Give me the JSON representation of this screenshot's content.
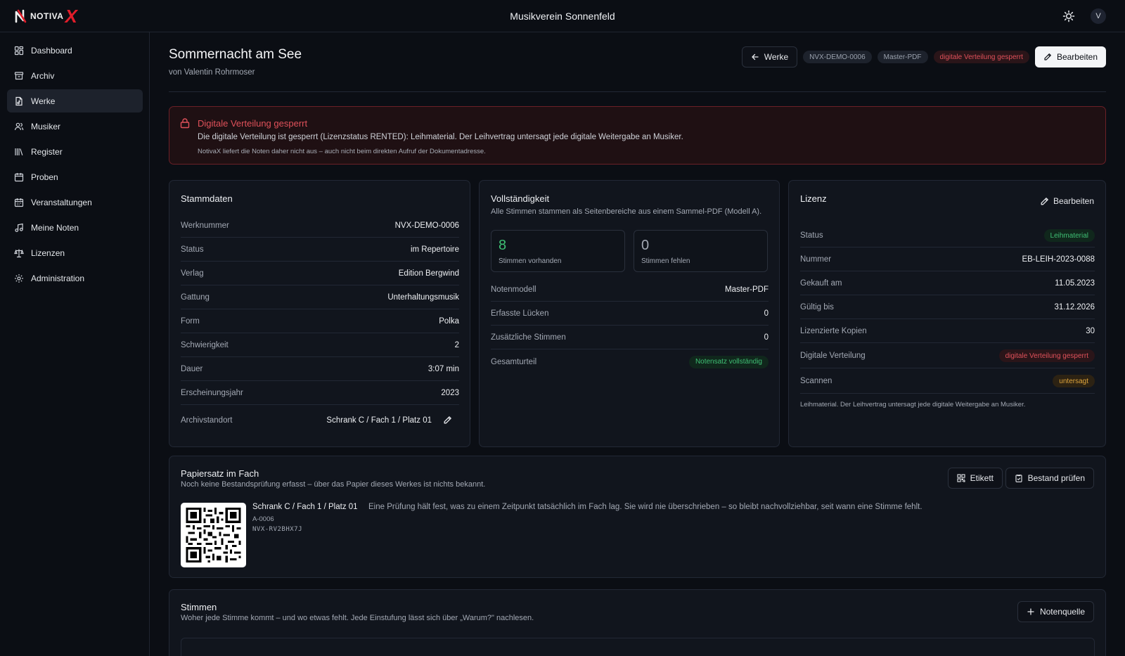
{
  "app": {
    "logo_text": "NOTIVA",
    "logo_x": "X",
    "org_name": "Musikverein Sonnenfeld",
    "avatar_initial": "V"
  },
  "sidebar": {
    "items": [
      {
        "label": "Dashboard",
        "icon": "dashboard-icon"
      },
      {
        "label": "Archiv",
        "icon": "archive-icon"
      },
      {
        "label": "Werke",
        "icon": "works-icon",
        "active": true
      },
      {
        "label": "Musiker",
        "icon": "users-icon"
      },
      {
        "label": "Register",
        "icon": "library-icon"
      },
      {
        "label": "Proben",
        "icon": "calendar-icon"
      },
      {
        "label": "Veranstaltungen",
        "icon": "calendar-icon"
      },
      {
        "label": "Meine Noten",
        "icon": "music-icon"
      },
      {
        "label": "Lizenzen",
        "icon": "scale-icon"
      },
      {
        "label": "Administration",
        "icon": "gear-icon"
      }
    ]
  },
  "header": {
    "title": "Sommernacht am See",
    "subtitle": "von Valentin Rohrmoser",
    "back_label": "Werke",
    "chips": [
      "NVX-DEMO-0006",
      "Master-PDF",
      "digitale Verteilung gesperrt"
    ],
    "edit_label": "Bearbeiten"
  },
  "alert": {
    "title": "Digitale Verteilung gesperrt",
    "text": "Die digitale Verteilung ist gesperrt (Lizenzstatus RENTED): Leihmaterial. Der Leihvertrag untersagt jede digitale Weitergabe an Musiker.",
    "note": "NotivaX liefert die Noten daher nicht aus – auch nicht beim direkten Aufruf der Dokumentadresse."
  },
  "stammdaten": {
    "title": "Stammdaten",
    "rows": [
      {
        "k": "Werknummer",
        "v": "NVX-DEMO-0006"
      },
      {
        "k": "Status",
        "v": "im Repertoire"
      },
      {
        "k": "Verlag",
        "v": "Edition Bergwind"
      },
      {
        "k": "Gattung",
        "v": "Unterhaltungsmusik"
      },
      {
        "k": "Form",
        "v": "Polka"
      },
      {
        "k": "Schwierigkeit",
        "v": "2"
      },
      {
        "k": "Dauer",
        "v": "3:07 min"
      },
      {
        "k": "Erscheinungsjahr",
        "v": "2023"
      },
      {
        "k": "Archivstandort",
        "v": "Schrank C / Fach 1 / Platz 01"
      }
    ]
  },
  "vollstaendigkeit": {
    "title": "Vollständigkeit",
    "subtitle": "Alle Stimmen stammen als Seitenbereiche aus einem Sammel-PDF (Modell A).",
    "present_count": "8",
    "present_label": "Stimmen vorhanden",
    "missing_count": "0",
    "missing_label": "Stimmen fehlen",
    "rows": [
      {
        "k": "Notenmodell",
        "v": "Master-PDF"
      },
      {
        "k": "Erfasste Lücken",
        "v": "0"
      },
      {
        "k": "Zusätzliche Stimmen",
        "v": "0"
      },
      {
        "k": "Gesamturteil",
        "v": "Notensatz vollständig"
      }
    ]
  },
  "lizenz": {
    "title": "Lizenz",
    "edit_label": "Bearbeiten",
    "rows": [
      {
        "k": "Status",
        "v": "Leihmaterial"
      },
      {
        "k": "Nummer",
        "v": "EB-LEIH-2023-0088"
      },
      {
        "k": "Gekauft am",
        "v": "11.05.2023"
      },
      {
        "k": "Gültig bis",
        "v": "31.12.2026"
      },
      {
        "k": "Lizenzierte Kopien",
        "v": "30"
      },
      {
        "k": "Digitale Verteilung",
        "v": "digitale Verteilung gesperrt"
      },
      {
        "k": "Scannen",
        "v": "untersagt"
      }
    ],
    "note": "Leihmaterial. Der Leihvertrag untersagt jede digitale Weitergabe an Musiker."
  },
  "papiersatz": {
    "title": "Papiersatz im Fach",
    "subtitle": "Noch keine Bestandsprüfung erfasst – über das Papier dieses Werkes ist nichts bekannt.",
    "label_button": "Etikett",
    "check_button": "Bestand prüfen",
    "location": "Schrank C / Fach 1 / Platz 01",
    "description": "Eine Prüfung hält fest, was zu einem Zeitpunkt tatsächlich im Fach lag. Sie wird nie überschrieben – so bleibt nachvollziehbar, seit wann eine Stimme fehlt.",
    "shelf_id": "A-0006",
    "code": "NVX-RV2BHX7J"
  },
  "stimmen": {
    "title": "Stimmen",
    "subtitle": "Woher jede Stimme kommt – und wo etwas fehlt. Jede Einstufung lässt sich über „Warum?\" nachlesen.",
    "add_button": "Notenquelle"
  },
  "colors": {
    "accent_red": "#e0515a",
    "success_green": "#3fbf74",
    "warning_amber": "#e0a53b",
    "background": "#0b0e14",
    "card": "#11151d"
  }
}
